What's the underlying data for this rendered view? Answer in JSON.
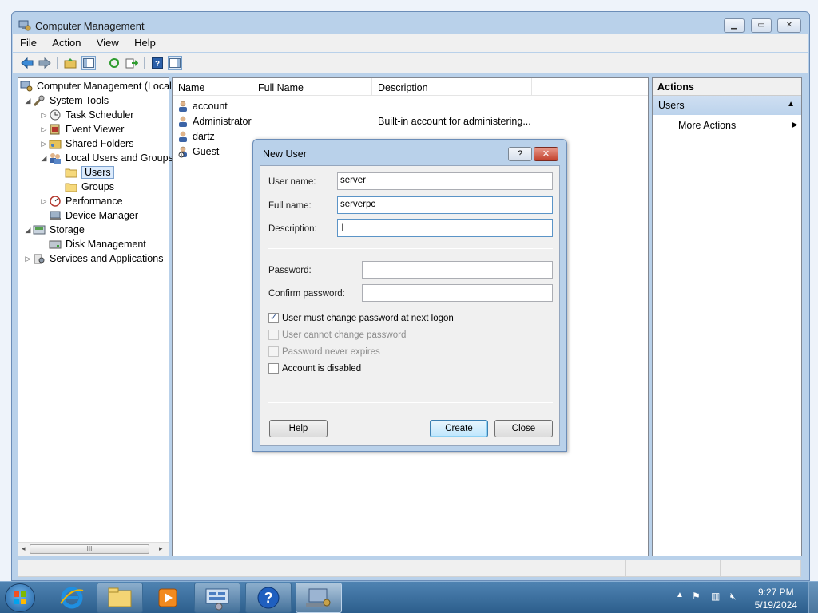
{
  "window": {
    "title": "Computer Management",
    "controls": [
      "minimize",
      "maximize",
      "close"
    ]
  },
  "menu": [
    "File",
    "Action",
    "View",
    "Help"
  ],
  "toolbar": {
    "buttons": [
      "back-icon",
      "forward-icon",
      "up-folder-icon",
      "show-hide-tree-icon",
      "refresh-icon",
      "export-list-icon",
      "help-icon",
      "show-hide-action-pane-icon"
    ]
  },
  "tree": {
    "root": "Computer Management (Local",
    "items": [
      {
        "label": "System Tools",
        "expanded": true
      },
      {
        "label": "Task Scheduler"
      },
      {
        "label": "Event Viewer"
      },
      {
        "label": "Shared Folders"
      },
      {
        "label": "Local Users and Groups",
        "expanded": true
      },
      {
        "label": "Users",
        "selected": true
      },
      {
        "label": "Groups"
      },
      {
        "label": "Performance"
      },
      {
        "label": "Device Manager"
      },
      {
        "label": "Storage",
        "expanded": true
      },
      {
        "label": "Disk Management"
      },
      {
        "label": "Services and Applications"
      }
    ],
    "scroll_grip": "III"
  },
  "list": {
    "columns": [
      "Name",
      "Full Name",
      "Description"
    ],
    "rows": [
      {
        "name": "account",
        "full_name": "",
        "description": ""
      },
      {
        "name": "Administrator",
        "full_name": "",
        "description": "Built-in account for administering..."
      },
      {
        "name": "dartz",
        "full_name": "",
        "description": ""
      },
      {
        "name": "Guest",
        "full_name": "",
        "description": ""
      }
    ]
  },
  "actions": {
    "title": "Actions",
    "section": "Users",
    "more": "More Actions"
  },
  "dialog": {
    "title": "New User",
    "help_glyph": "?",
    "close_glyph": "✕",
    "fields": {
      "username_label": "User name:",
      "username_value": "server",
      "fullname_label": "Full name:",
      "fullname_value": "serverpc",
      "description_label": "Description:",
      "description_value": "",
      "password_label": "Password:",
      "confirm_label": "Confirm password:"
    },
    "checkboxes": [
      {
        "label": "User must change password at next logon",
        "checked": true,
        "enabled": true
      },
      {
        "label": "User cannot change password",
        "checked": false,
        "enabled": false
      },
      {
        "label": "Password never expires",
        "checked": false,
        "enabled": false
      },
      {
        "label": "Account is disabled",
        "checked": false,
        "enabled": true
      }
    ],
    "buttons": {
      "help": "Help",
      "create": "Create",
      "close": "Close"
    }
  },
  "taskbar": {
    "time": "9:27 PM",
    "date": "5/19/2024"
  },
  "colors": {
    "window_frame": "#b9d1ea",
    "selection": "#dcebfc",
    "taskbar": "#3a6d9c",
    "default_button": "#bee6fd"
  }
}
